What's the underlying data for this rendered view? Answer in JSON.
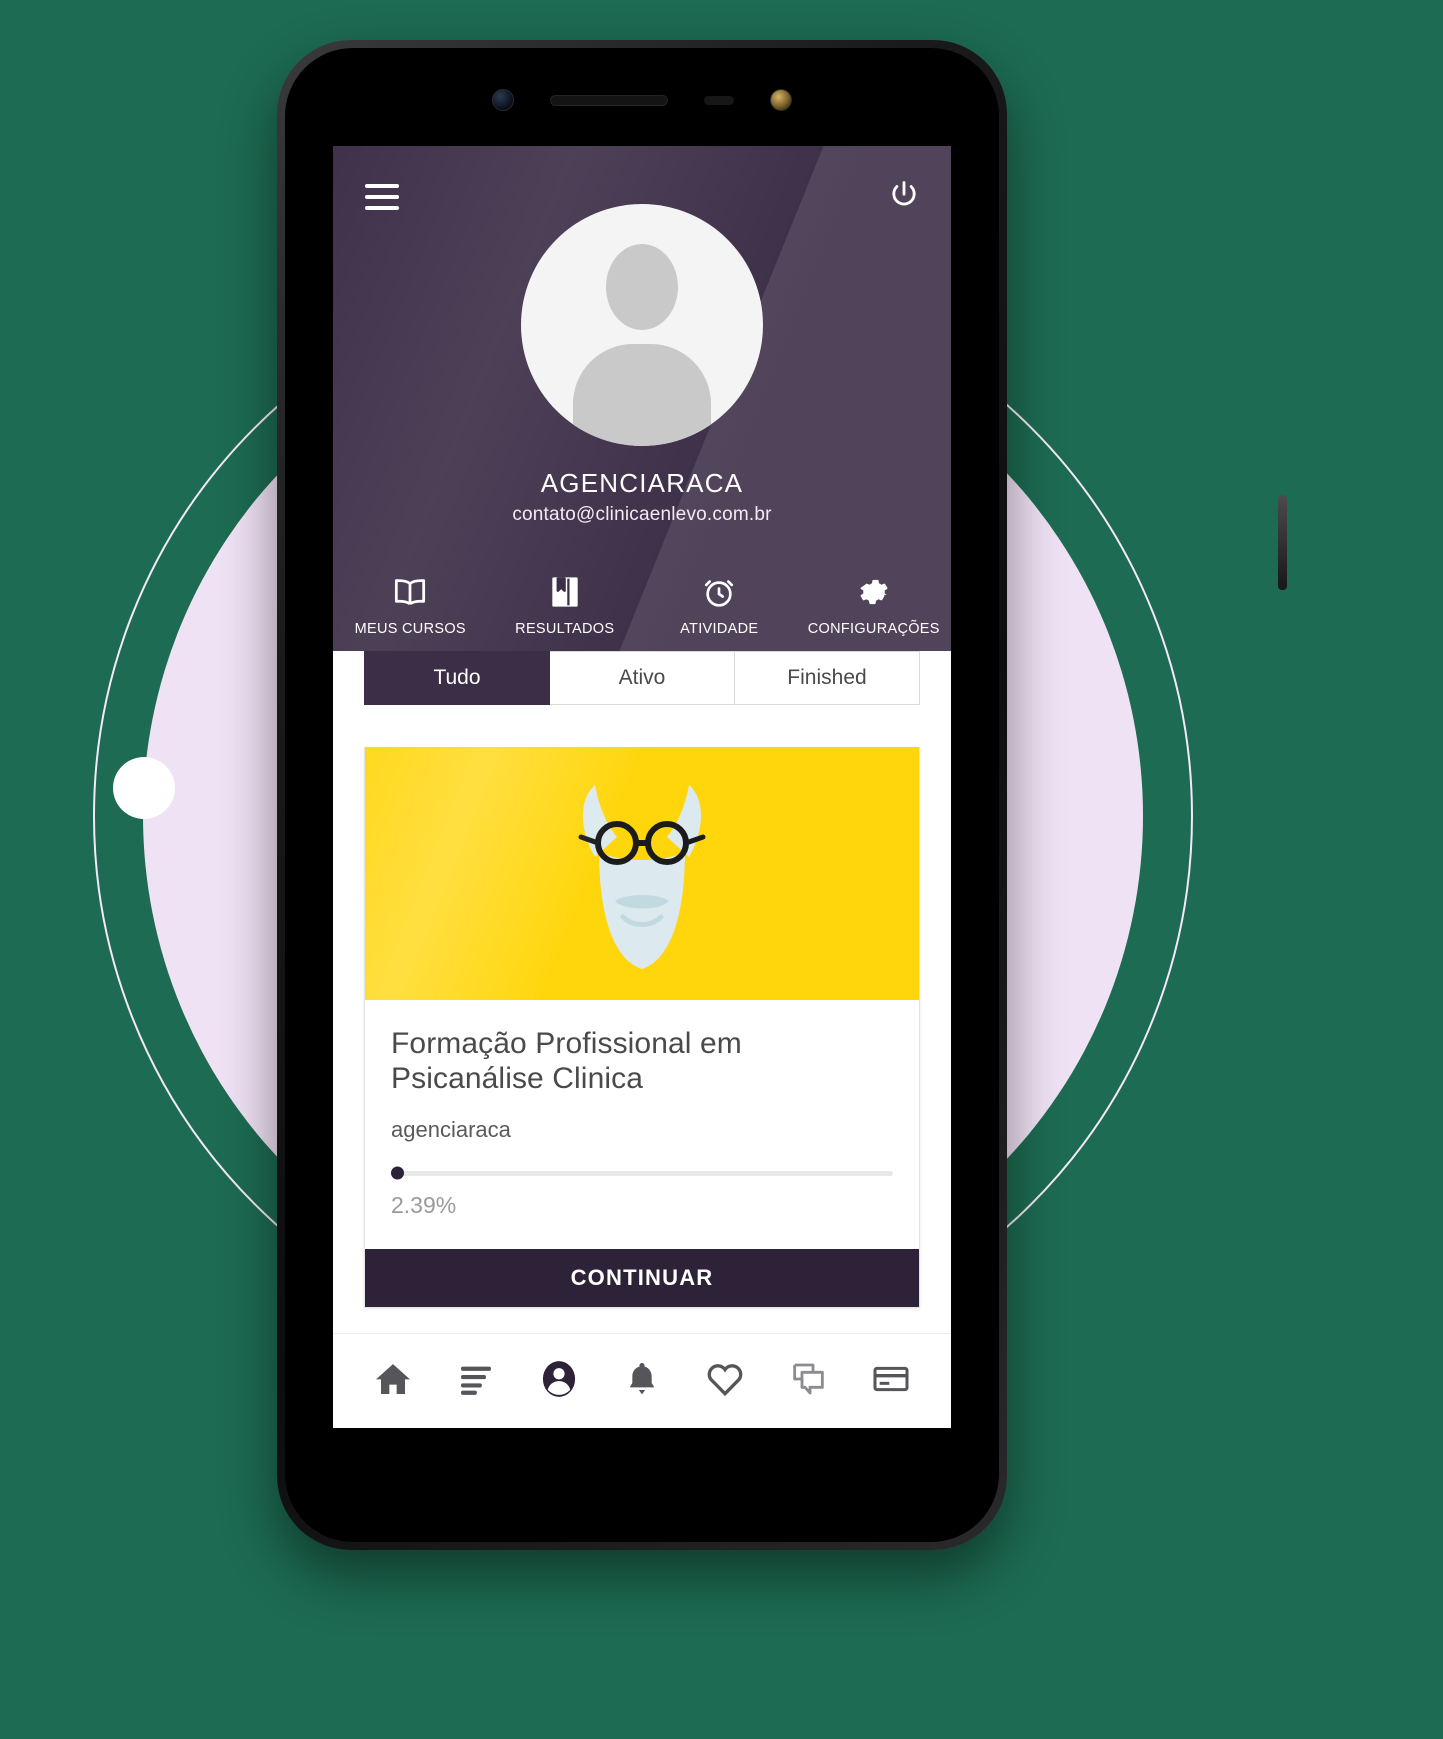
{
  "app": {
    "accent_purple": "#3c2e47",
    "accent_dark": "#2e2238",
    "thumb_yellow": "#ffd60b",
    "background_green": "#1d6b52",
    "halo_lilac": "#f0e2f5"
  },
  "header": {
    "menu_icon": "hamburger-menu-icon",
    "power_icon": "power-icon",
    "avatar_icon": "user-avatar-placeholder-icon",
    "name": "AGENCIARACA",
    "email": "contato@clinicaenlevo.com.br",
    "nav": [
      {
        "label": "MEUS CURSOS",
        "icon": "open-book-icon"
      },
      {
        "label": "RESULTADOS",
        "icon": "bookmark-book-icon"
      },
      {
        "label": "ATIVIDADE",
        "icon": "alarm-clock-icon"
      },
      {
        "label": "CONFIGURAÇÕES",
        "icon": "gear-icon"
      }
    ]
  },
  "tabs": [
    {
      "label": "Tudo",
      "active": true
    },
    {
      "label": "Ativo",
      "active": false
    },
    {
      "label": "Finished",
      "active": false
    }
  ],
  "course": {
    "thumbnail_icon": "freud-face-illustration",
    "title": "Formação Profissional em Psicanálise Clinica",
    "author": "agenciaraca",
    "progress_percent": 2.39,
    "progress_label": "2.39%",
    "continue_label": "CONTINUAR"
  },
  "bottom_bar": [
    {
      "icon": "home-icon",
      "active": false
    },
    {
      "icon": "list-lines-icon",
      "active": false
    },
    {
      "icon": "user-profile-icon",
      "active": true
    },
    {
      "icon": "bell-icon",
      "active": false
    },
    {
      "icon": "heart-icon",
      "active": false
    },
    {
      "icon": "chat-bubbles-icon",
      "active": false
    },
    {
      "icon": "credit-card-icon",
      "active": false
    }
  ]
}
